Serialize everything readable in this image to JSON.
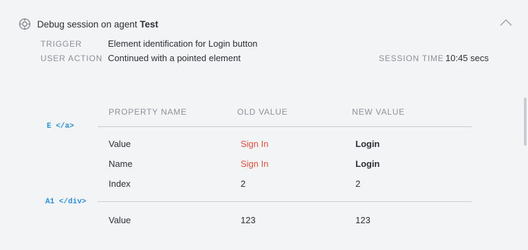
{
  "header": {
    "title_prefix": "Debug session on agent",
    "agent_name": "Test",
    "icon": "target-icon",
    "collapse_icon": "chevron-up-icon"
  },
  "meta": {
    "trigger_label": "TRIGGER",
    "trigger_value": "Element identification for Login button",
    "user_action_label": "USER ACTION",
    "user_action_value": "Continued with a pointed element",
    "session_time_label": "SESSION TIME",
    "session_time_value": "10:45 secs"
  },
  "table": {
    "headers": [
      "PROPERTY NAME",
      "OLD VALUE",
      "NEW VALUE"
    ],
    "groups": [
      {
        "element": "E </a>",
        "rows": [
          {
            "property": "Value",
            "old": "Sign In",
            "new": "Login"
          },
          {
            "property": "Name",
            "old": "Sign In",
            "new": "Login"
          },
          {
            "property": "Index",
            "old": "2",
            "new": "2"
          }
        ]
      },
      {
        "element": "A1 </div>",
        "rows": [
          {
            "property": "Value",
            "old": "123",
            "new": "123"
          }
        ]
      }
    ]
  },
  "colors": {
    "changed_old": "#e0513f",
    "element_tag": "#2a8fd8",
    "label_gray": "#8b9099",
    "background": "#f3f4f6"
  }
}
